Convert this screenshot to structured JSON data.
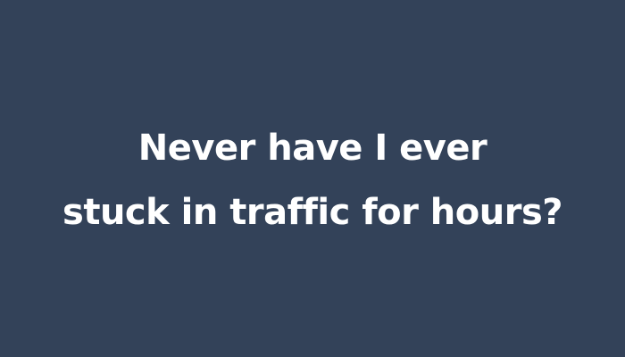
{
  "card": {
    "background_color": "#334259",
    "text_color": "#ffffff",
    "line1": "Never have I ever",
    "line2": "stuck in traffic for hours?"
  }
}
